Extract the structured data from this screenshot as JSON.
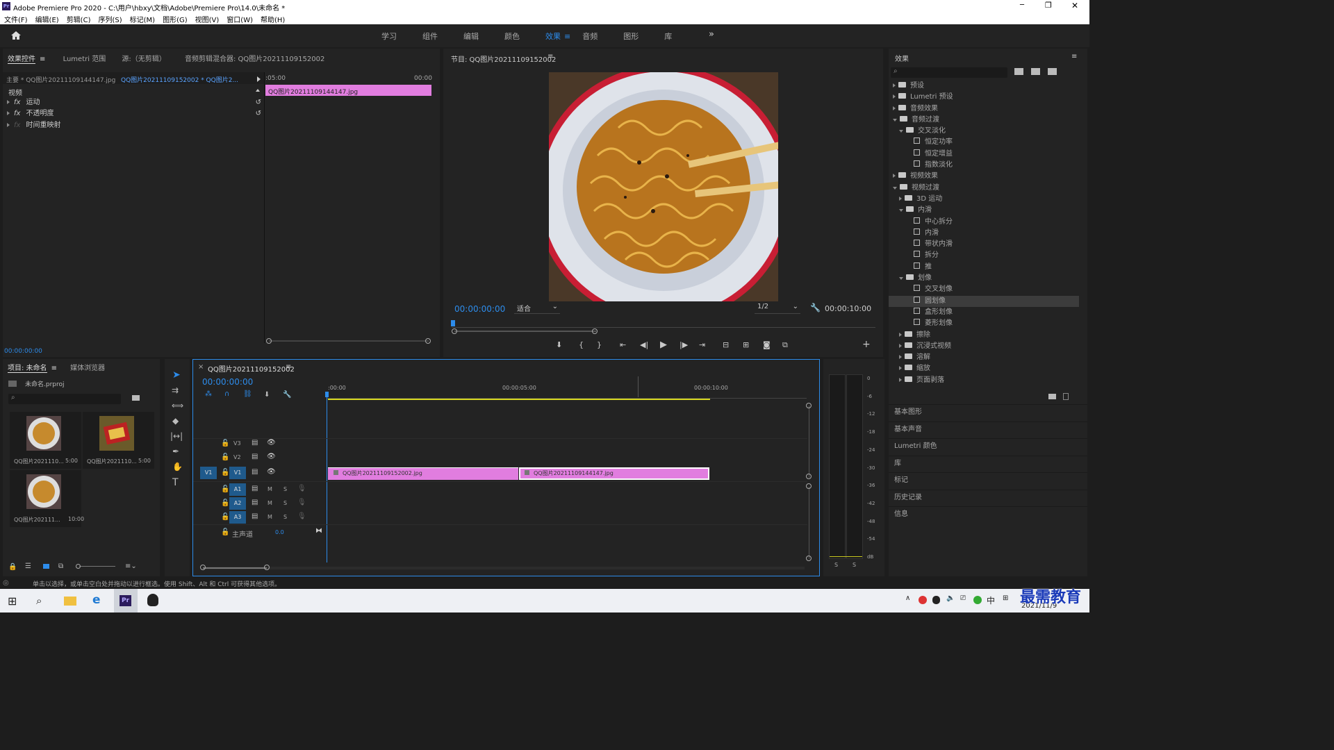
{
  "app": {
    "title": "Adobe Premiere Pro 2020 - C:\\用户\\hbxy\\文档\\Adobe\\Premiere Pro\\14.0\\未命名 *",
    "icon": "Pr"
  },
  "window": {
    "minimize": "─",
    "maximize": "❐",
    "close": "✕"
  },
  "menu": [
    "文件(F)",
    "编辑(E)",
    "剪辑(C)",
    "序列(S)",
    "标记(M)",
    "图形(G)",
    "视图(V)",
    "窗口(W)",
    "帮助(H)"
  ],
  "workspaces": [
    "学习",
    "组件",
    "编辑",
    "颜色",
    "效果",
    "音频",
    "图形",
    "库"
  ],
  "workspace_active": "效果",
  "workspace_more": "»",
  "effect_controls": {
    "tabs": [
      "效果控件",
      "Lumetri 范围",
      "源:（无剪辑）",
      "音频剪辑混合器: QQ图片20211109152002"
    ],
    "master": "主要 * QQ图片20211109144147.jpg",
    "clip": "QQ图片20211109152002 * QQ图片2...",
    "time_a": ":05:00",
    "time_b": "00:00",
    "section": "视频",
    "rows": [
      "运动",
      "不透明度",
      "时间重映射"
    ],
    "clip_bar": "QQ图片20211109144147.jpg",
    "timecode": "00:00:00:00"
  },
  "program": {
    "title": "节目: QQ图片20211109152002",
    "timecode": "00:00:00:00",
    "fit": "适合",
    "quality": "1/2",
    "duration": "00:00:10:00"
  },
  "effects_panel": {
    "title": "效果",
    "tree": [
      {
        "label": "预设",
        "level": 0,
        "open": false,
        "type": "folder"
      },
      {
        "label": "Lumetri 预设",
        "level": 0,
        "open": false,
        "type": "folder"
      },
      {
        "label": "音频效果",
        "level": 0,
        "open": false,
        "type": "folder"
      },
      {
        "label": "音频过渡",
        "level": 0,
        "open": true,
        "type": "folder"
      },
      {
        "label": "交叉淡化",
        "level": 1,
        "open": true,
        "type": "folder"
      },
      {
        "label": "恒定功率",
        "level": 2,
        "type": "item"
      },
      {
        "label": "恒定增益",
        "level": 2,
        "type": "item"
      },
      {
        "label": "指数淡化",
        "level": 2,
        "type": "item"
      },
      {
        "label": "视频效果",
        "level": 0,
        "open": false,
        "type": "folder"
      },
      {
        "label": "视频过渡",
        "level": 0,
        "open": true,
        "type": "folder"
      },
      {
        "label": "3D 运动",
        "level": 1,
        "open": false,
        "type": "folder"
      },
      {
        "label": "内滑",
        "level": 1,
        "open": true,
        "type": "folder"
      },
      {
        "label": "中心拆分",
        "level": 2,
        "type": "item"
      },
      {
        "label": "内滑",
        "level": 2,
        "type": "item"
      },
      {
        "label": "带状内滑",
        "level": 2,
        "type": "item"
      },
      {
        "label": "拆分",
        "level": 2,
        "type": "item"
      },
      {
        "label": "推",
        "level": 2,
        "type": "item"
      },
      {
        "label": "划像",
        "level": 1,
        "open": true,
        "type": "folder"
      },
      {
        "label": "交叉划像",
        "level": 2,
        "type": "item"
      },
      {
        "label": "圆划像",
        "level": 2,
        "type": "item",
        "selected": true
      },
      {
        "label": "盒形划像",
        "level": 2,
        "type": "item"
      },
      {
        "label": "菱形划像",
        "level": 2,
        "type": "item"
      },
      {
        "label": "擦除",
        "level": 1,
        "open": false,
        "type": "folder"
      },
      {
        "label": "沉浸式视频",
        "level": 1,
        "open": false,
        "type": "folder"
      },
      {
        "label": "溶解",
        "level": 1,
        "open": false,
        "type": "folder"
      },
      {
        "label": "缩放",
        "level": 1,
        "open": false,
        "type": "folder"
      },
      {
        "label": "页面剥落",
        "level": 1,
        "open": false,
        "type": "folder"
      }
    ],
    "sections": [
      "基本图形",
      "基本声音",
      "Lumetri 颜色",
      "库",
      "标记",
      "历史记录",
      "信息"
    ]
  },
  "project": {
    "tabs": [
      "项目: 未命名",
      "媒体浏览器"
    ],
    "file": "未命名.prproj",
    "items": [
      {
        "name": "QQ图片2021110...",
        "dur": "5:00"
      },
      {
        "name": "QQ图片2021110...",
        "dur": "5:00"
      },
      {
        "name": "QQ图片202111...",
        "dur": "10:00"
      }
    ]
  },
  "timeline": {
    "tab": "QQ图片20211109152002",
    "timecode": "00:00:00:00",
    "ruler": [
      ":00:00",
      "00:00:05:00",
      "00:00:10:00"
    ],
    "video_tracks": [
      "V3",
      "V2",
      "V1"
    ],
    "audio_tracks": [
      "A1",
      "A2",
      "A3"
    ],
    "source": "V1",
    "master": "主声道",
    "master_val": "0.0",
    "clips": [
      "QQ图片20211109152002.jpg",
      "QQ图片20211109144147.jpg"
    ],
    "M": "M",
    "S": "S"
  },
  "meter": {
    "scale": [
      "0",
      "-6",
      "-12",
      "-18",
      "-24",
      "-30",
      "-36",
      "-42",
      "-48",
      "-54",
      "dB"
    ],
    "S": "S"
  },
  "status": "单击以选择，或单击空白处并拖动以进行框选。使用 Shift、Alt 和 Ctrl 可获得其他选项。",
  "taskbar": {
    "ime": "中",
    "date": "2021/11/9",
    "watermark": "最需教育"
  },
  "colors": {
    "accent": "#2d8ceb",
    "clip": "#e17ddf",
    "bg": "#232323"
  }
}
